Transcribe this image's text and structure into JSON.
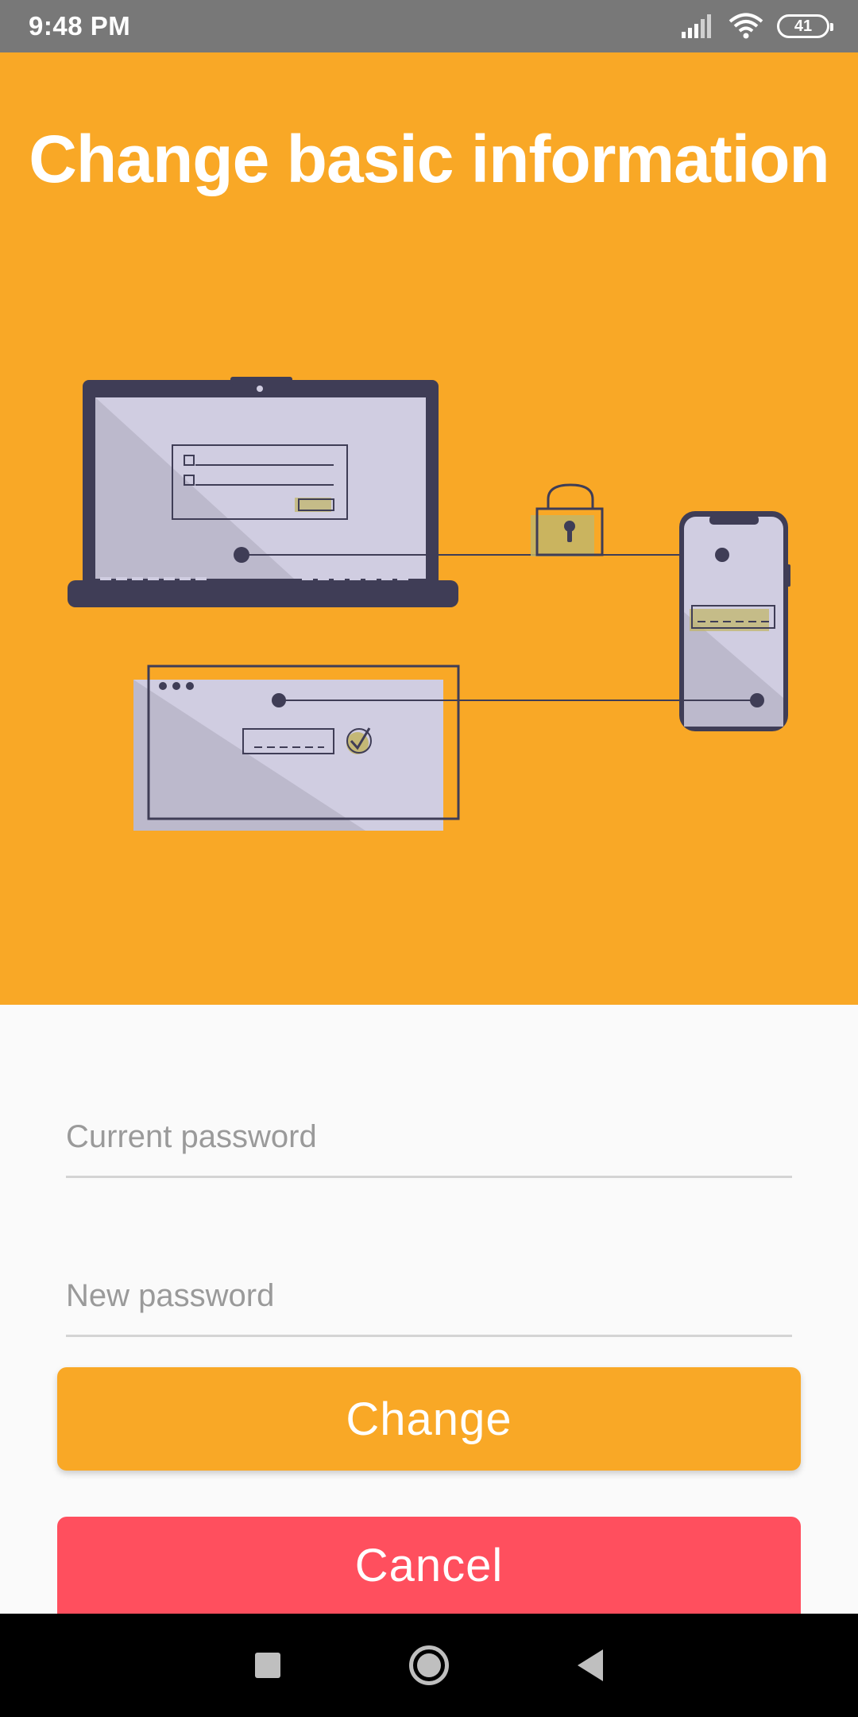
{
  "status_bar": {
    "time": "9:48 PM",
    "battery_level": "41",
    "icons": [
      "signal-icon",
      "wifi-icon",
      "battery-icon"
    ]
  },
  "header": {
    "title": "Change basic information",
    "background_color": "#f9a826"
  },
  "form": {
    "current_password_placeholder": "Current password",
    "new_password_placeholder": "New password",
    "change_label": "Change",
    "cancel_label": "Cancel"
  },
  "colors": {
    "accent": "#f9a826",
    "danger": "#ff4f5e",
    "illustration_dark": "#3f3d56",
    "illustration_screen": "#d0cde1"
  },
  "nav_bar": {
    "icons": [
      "recents-icon",
      "home-icon",
      "back-icon"
    ]
  }
}
